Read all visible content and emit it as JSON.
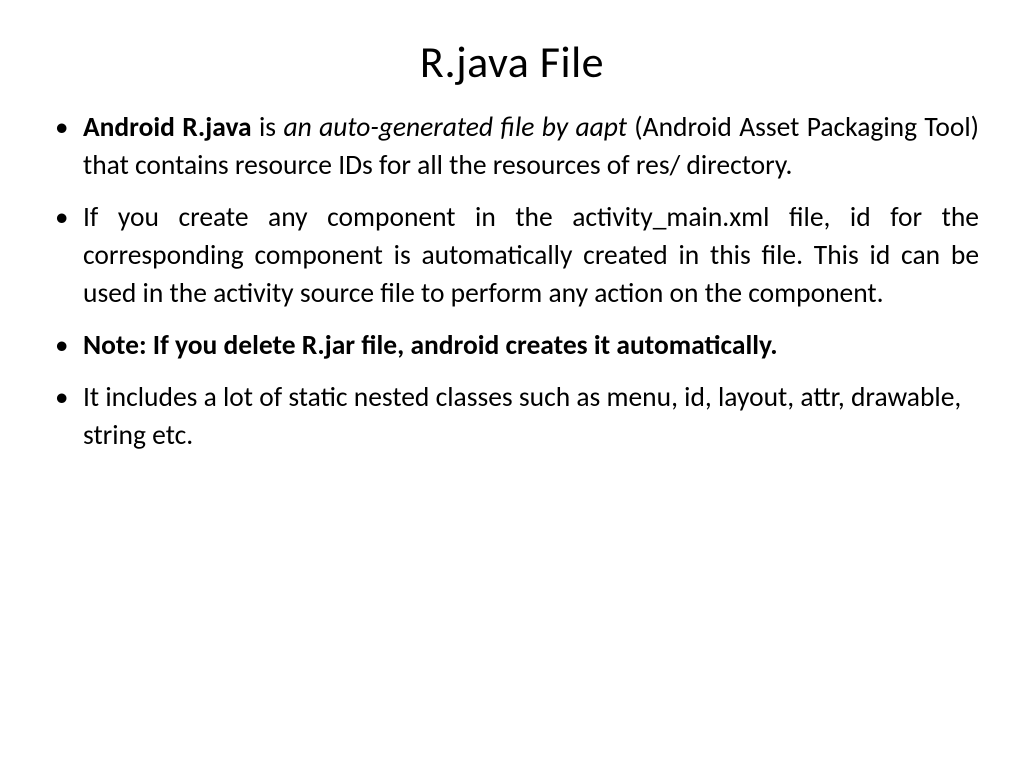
{
  "title": "R.java File",
  "bullets": {
    "b1": {
      "seg1": "Android R.java",
      "seg2": " is ",
      "seg3": "an auto-generated file by aapt",
      "seg4": " (Android Asset Packaging Tool) that contains resource IDs for all the resources of res/ directory."
    },
    "b2": "If you create any component in the activity_main.xml file, id for the corresponding component is automatically created in this file. This id can be used in the activity source file to perform any action on the component.",
    "b3": "Note: If you delete R.jar file, android creates it automatically.",
    "b4": "It includes a lot of static nested classes such as menu, id, layout, attr, drawable, string etc."
  }
}
